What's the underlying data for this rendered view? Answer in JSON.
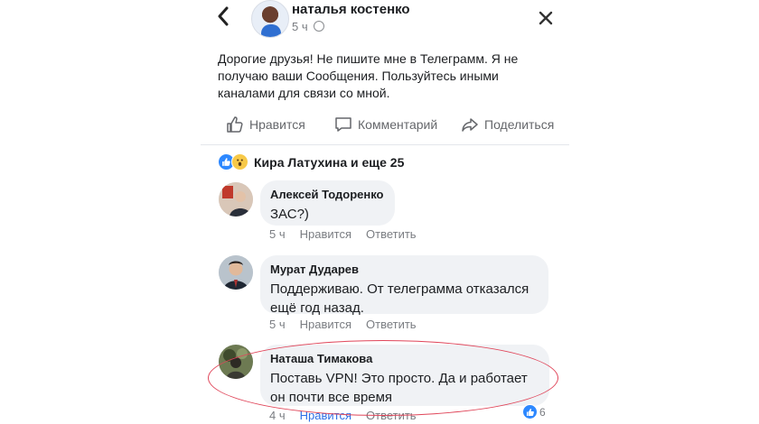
{
  "post": {
    "back_icon": "chevron-left-icon",
    "author": "наталья костенко",
    "time": "5 ч",
    "privacy_icon": "globe-icon",
    "close_icon": "close-icon",
    "text": "Дорогие друзья! Не пишите мне в Телеграмм. Я не получаю ваши Сообщения. Пользуйтесь иными каналами для связи со мной.",
    "actions": {
      "like": "Нравится",
      "comment": "Комментарий",
      "share": "Поделиться"
    }
  },
  "reactions": {
    "summary": "Кира Латухина и еще 25",
    "types": [
      "like",
      "wow"
    ]
  },
  "comments": [
    {
      "author": "Алексей Тодоренко",
      "text": "ЗАС?)",
      "time": "5 ч",
      "like": "Нравится",
      "reply": "Ответить",
      "liked": false
    },
    {
      "author": "Мурат Дударев",
      "text": "Поддерживаю. От телеграмма отказался ещё год назад.",
      "time": "5 ч",
      "like": "Нравится",
      "reply": "Ответить",
      "liked": false
    },
    {
      "author": "Наташа Тимакова",
      "text": "Поставь VPN! Это просто. Да и работает он почти все время",
      "time": "4 ч",
      "like": "Нравится",
      "reply": "Ответить",
      "liked": true,
      "reaction_count": "6"
    }
  ],
  "colors": {
    "accent": "#2d88ff",
    "liked_text": "#2d6fe6",
    "highlight_circle": "#e0465a",
    "bubble": "#f0f2f5"
  }
}
